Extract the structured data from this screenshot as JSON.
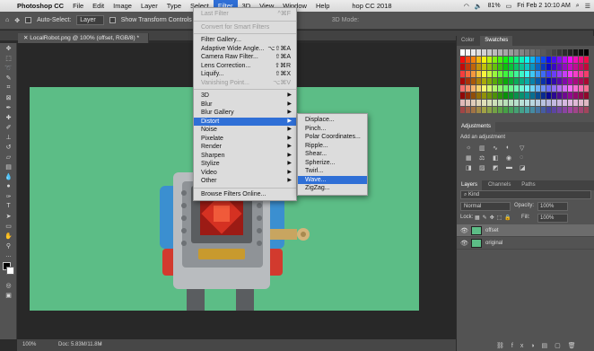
{
  "menubar": {
    "app": "Photoshop CC",
    "items": [
      "File",
      "Edit",
      "Image",
      "Layer",
      "Type",
      "Select",
      "Filter",
      "3D",
      "View",
      "Window",
      "Help"
    ],
    "active": "Filter",
    "window_title_fragment": "hop CC 2018",
    "battery": "81%",
    "datetime": "Fri Feb 2  10:10 AM"
  },
  "options": {
    "auto_select_label": "Auto-Select:",
    "auto_select_value": "Layer",
    "show_transform": "Show Transform Controls",
    "mode_3d": "3D Mode:"
  },
  "document": {
    "tab_label": "LocalRobot.png @ 100% (offset, RGB/8) *",
    "zoom": "100%",
    "doc_info": "Doc: 5.83M/11.8M"
  },
  "filter_menu": {
    "items": [
      {
        "label": "Last Filter",
        "shortcut": "^⌘F",
        "disabled": true
      },
      {
        "sep": true
      },
      {
        "label": "Convert for Smart Filters",
        "disabled": true
      },
      {
        "sep": true
      },
      {
        "label": "Filter Gallery...",
        "shortcut": ""
      },
      {
        "label": "Adaptive Wide Angle...",
        "shortcut": "⌥⇧⌘A"
      },
      {
        "label": "Camera Raw Filter...",
        "shortcut": "⇧⌘A"
      },
      {
        "label": "Lens Correction...",
        "shortcut": "⇧⌘R"
      },
      {
        "label": "Liquify...",
        "shortcut": "⇧⌘X"
      },
      {
        "label": "Vanishing Point...",
        "shortcut": "⌥⌘V",
        "disabled": true
      },
      {
        "sep": true
      },
      {
        "label": "3D",
        "sub": true
      },
      {
        "label": "Blur",
        "sub": true
      },
      {
        "label": "Blur Gallery",
        "sub": true
      },
      {
        "label": "Distort",
        "sub": true,
        "highlight": true
      },
      {
        "label": "Noise",
        "sub": true
      },
      {
        "label": "Pixelate",
        "sub": true
      },
      {
        "label": "Render",
        "sub": true
      },
      {
        "label": "Sharpen",
        "sub": true
      },
      {
        "label": "Stylize",
        "sub": true
      },
      {
        "label": "Video",
        "sub": true
      },
      {
        "label": "Other",
        "sub": true
      },
      {
        "sep": true
      },
      {
        "label": "Browse Filters Online..."
      }
    ]
  },
  "distort_menu": {
    "items": [
      {
        "label": "Displace..."
      },
      {
        "label": "Pinch..."
      },
      {
        "label": "Polar Coordinates..."
      },
      {
        "label": "Ripple..."
      },
      {
        "label": "Shear..."
      },
      {
        "label": "Spherize..."
      },
      {
        "label": "Twirl..."
      },
      {
        "label": "Wave...",
        "highlight": true
      },
      {
        "label": "ZigZag..."
      }
    ]
  },
  "panels": {
    "color_tabs": [
      "Color",
      "Swatches"
    ],
    "adjustments_title": "Adjustments",
    "adjustments_hint": "Add an adjustment",
    "layers_tabs": [
      "Layers",
      "Channels",
      "Paths"
    ],
    "kind_label": "Kind",
    "blend_mode": "Normal",
    "opacity_label": "Opacity:",
    "opacity_value": "100%",
    "lock_label": "Lock:",
    "fill_label": "Fill:",
    "fill_value": "100%",
    "layers": [
      {
        "name": "offset",
        "selected": true
      },
      {
        "name": "original",
        "selected": false
      }
    ]
  },
  "colors": {
    "canvas": "#5cbd86",
    "menu_highlight": "#2f6fd6"
  }
}
